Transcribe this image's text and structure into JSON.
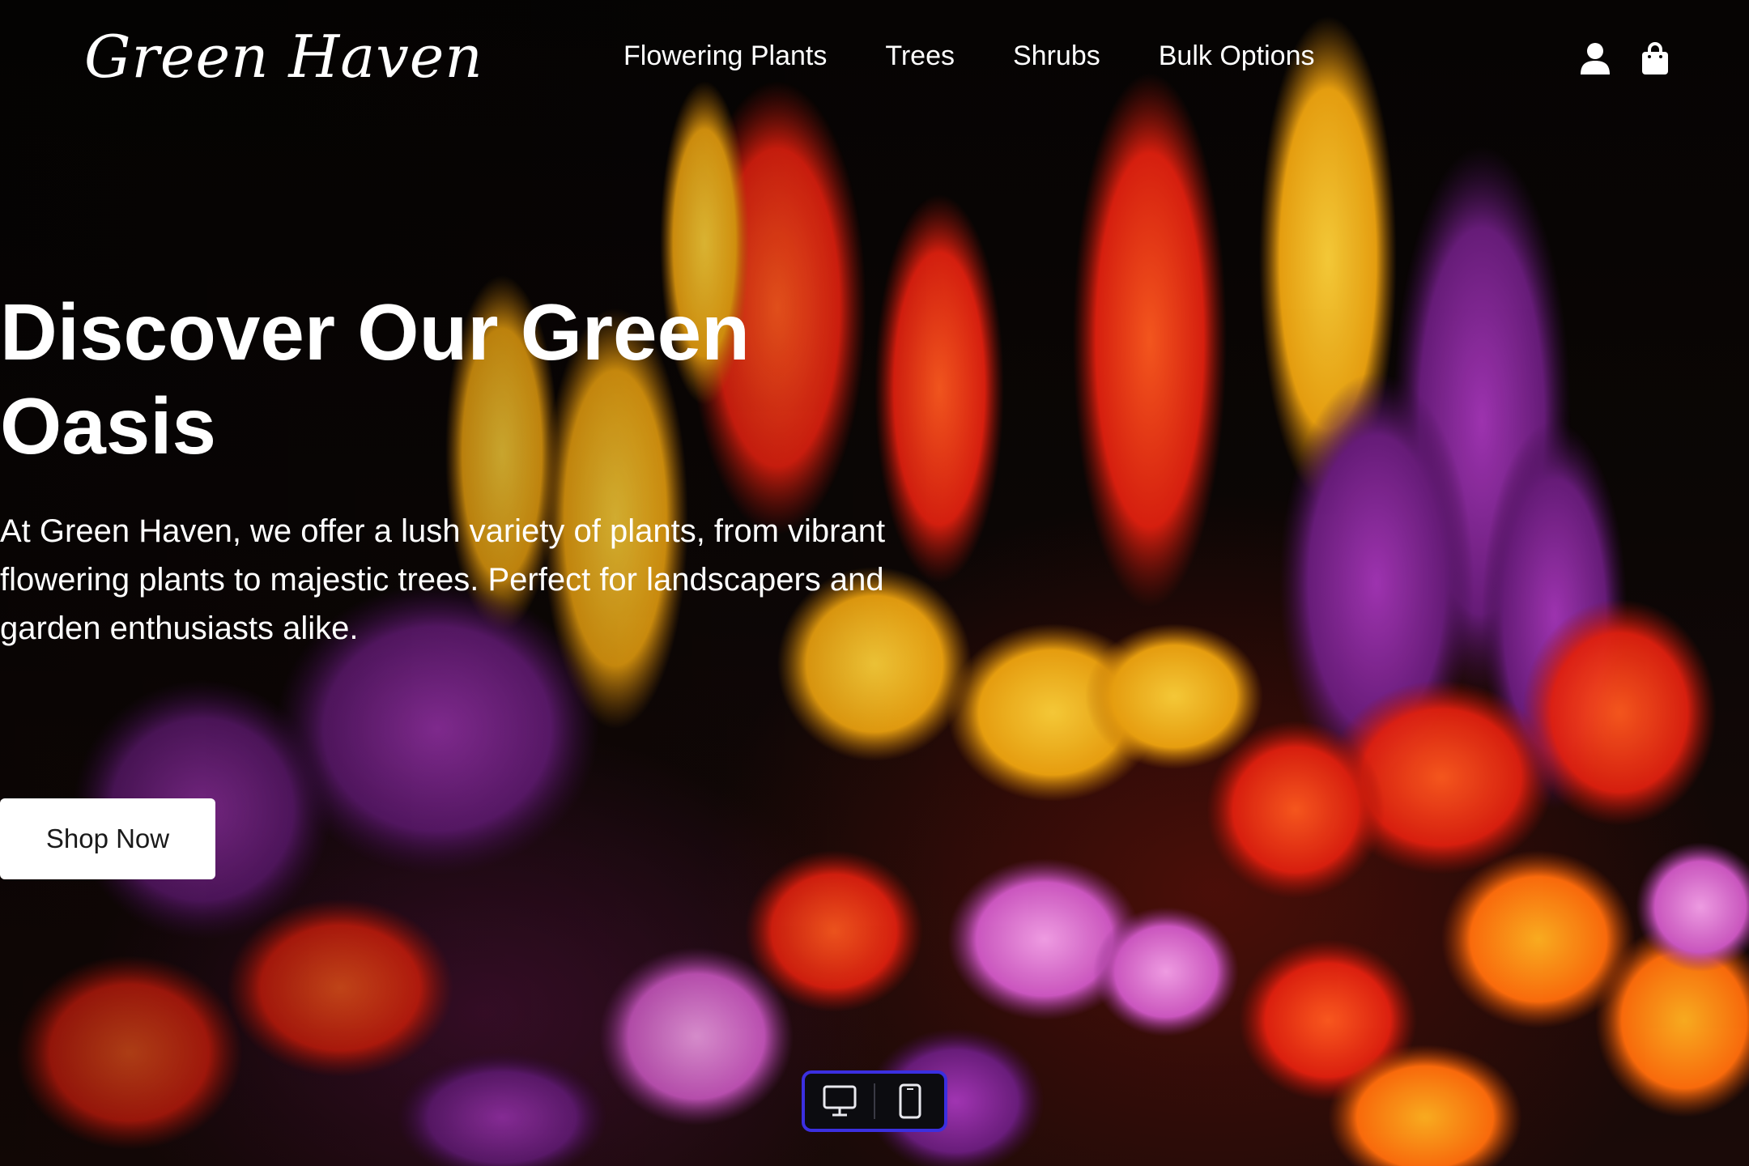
{
  "brand": {
    "logo_text": "Green Haven"
  },
  "nav": {
    "items": [
      {
        "label": "Flowering Plants"
      },
      {
        "label": "Trees"
      },
      {
        "label": "Shrubs"
      },
      {
        "label": "Bulk Options"
      }
    ]
  },
  "header_icons": {
    "account_icon": "user-icon",
    "cart_icon": "shopping-bag-icon"
  },
  "hero": {
    "title": "Discover Our Green Oasis",
    "description": "At Green Haven, we offer a lush variety of plants, from vibrant flowering plants to majestic trees. Perfect for landscapers and garden enthusiasts alike.",
    "cta_label": "Shop Now",
    "background_subject": "flower-bouquet-image"
  },
  "device_toggle": {
    "options": [
      {
        "icon": "desktop-icon"
      },
      {
        "icon": "mobile-icon"
      }
    ]
  },
  "colors": {
    "background": "#050403",
    "text": "#ffffff",
    "button_bg": "#ffffff",
    "button_text": "#1a1a1a",
    "toggle_border": "#3b2fe0"
  }
}
